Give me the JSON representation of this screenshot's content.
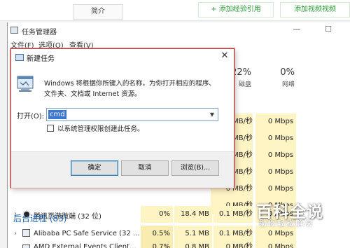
{
  "web": {
    "tab_intro": "简介",
    "btn_add_experience": "+ 添加经验引用",
    "btn_add_video": "添加视频视频"
  },
  "taskmanager": {
    "title": "任务管理器",
    "min_glyph": "—",
    "max_glyph": "☐",
    "menu": [
      "文件(F)",
      "选项(O)",
      "查看(V)"
    ],
    "columns": {
      "disk": {
        "percent": "22%",
        "name": "磁盘"
      },
      "network": {
        "percent": "0%",
        "name": "网络"
      }
    },
    "rows": [
      {
        "disk": "0 MB/秒",
        "net": "0 Mbps"
      },
      {
        "disk": "0 MB/秒",
        "net": "0 Mbps"
      },
      {
        "disk": "0 MB/秒",
        "net": "0 Mbps"
      },
      {
        "disk": "0 MB/秒",
        "net": "0 Mbps"
      },
      {
        "disk": "0 MB/秒",
        "net": "0 Mbps"
      },
      {
        "disk": "0 MB/秒",
        "net": "0 Mbps"
      }
    ],
    "process_qq": {
      "name": "腾讯页游微端 (32 位)",
      "cpu": "0%",
      "memory": "18.4 MB",
      "disk": "0.1 MB/秒",
      "net": "0 Mbps"
    },
    "background_header": "后台进程 (83)",
    "process_alibaba": {
      "name": "Alibaba PC Safe Service (32 ...",
      "cpu": "0.5%",
      "memory": "5.1 MB",
      "disk": "0.1 MB/秒",
      "net": "0 Mbps"
    },
    "process_amd": {
      "name": "AMD External Events Client...",
      "cpu": "0.7%",
      "memory": "0.8 MB",
      "disk": "0 MB/秒",
      "net": "0 Mbps"
    }
  },
  "run_dialog": {
    "title": "新建任务",
    "close_glyph": "✕",
    "description_line1": "Windows 将根据你所键入的名称，为你打开相应的程序、",
    "description_line2": "文件夹、文档或 Internet 资源。",
    "open_label": "打开(O):",
    "input_value": "cmd",
    "admin_checkbox_label": "以系统管理权限创建此任务。",
    "ok_label": "确定",
    "cancel_label": "取消",
    "browse_label": "浏览(B)..."
  },
  "watermark": {
    "title": "百科全说",
    "subtitle": "助你轻松解决"
  },
  "colors": {
    "accent_selection": "#3a78d4",
    "group_header": "#1f5fa8",
    "highlight_cell": "#fff4c4",
    "dialog_border": "#b03c3c"
  }
}
